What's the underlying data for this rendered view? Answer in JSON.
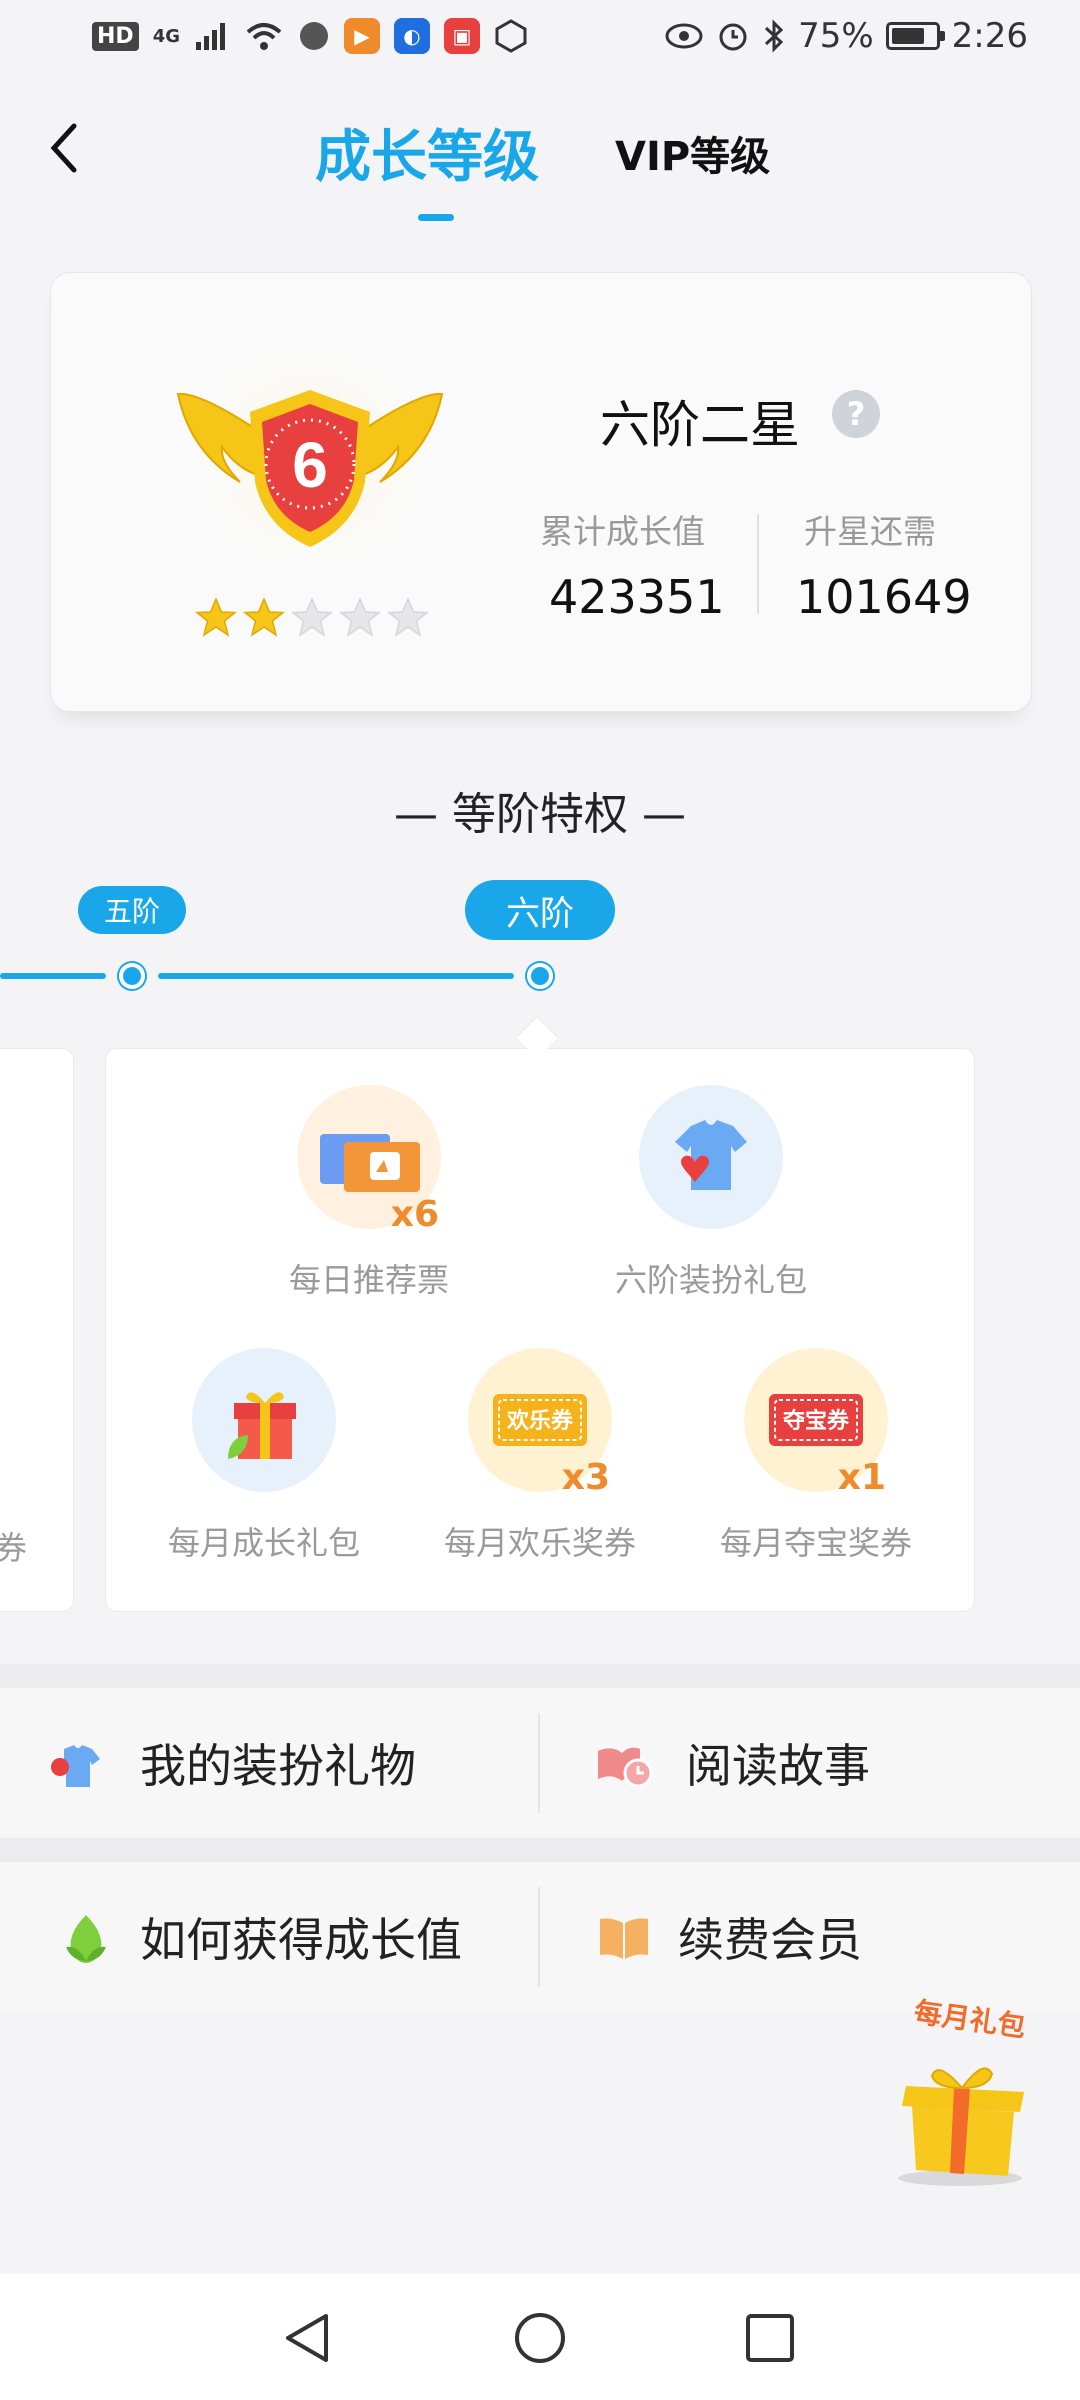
{
  "status_bar": {
    "hd": "HD",
    "network": "4G",
    "battery_text": "75%",
    "time": "2:26",
    "battery_level": 0.75
  },
  "header": {
    "tab_growth": "成长等级",
    "tab_vip": "VIP等级"
  },
  "level_card": {
    "badge_number": "6",
    "level_name": "六阶二星",
    "help": "?",
    "stars_filled": 2,
    "stars_total": 5,
    "cumulative_label": "累计成长值",
    "cumulative_value": "423351",
    "needed_label": "升星还需",
    "needed_value": "101649"
  },
  "privileges": {
    "title": "— 等阶特权 —",
    "stage_prev": "五阶",
    "stage_current": "六阶",
    "prev_panel_partial_text": "券",
    "items": [
      {
        "label": "每日推荐票",
        "badge": "x6",
        "icon": "recommend-ticket-icon"
      },
      {
        "label": "六阶装扮礼包",
        "badge": "",
        "icon": "tshirt-heart-icon"
      },
      {
        "label": "每月成长礼包",
        "badge": "",
        "icon": "gift-leaf-icon"
      },
      {
        "label": "每月欢乐奖券",
        "badge": "x3",
        "icon_text": "欢乐券",
        "icon": "joy-coupon-icon"
      },
      {
        "label": "每月夺宝奖券",
        "badge": "x1",
        "icon_text": "夺宝券",
        "icon": "treasure-coupon-icon"
      }
    ]
  },
  "menu": {
    "my_dressup": "我的装扮礼物",
    "read_story": "阅读故事",
    "how_to_grow": "如何获得成长值",
    "renew_vip": "续费会员"
  },
  "float_gift": {
    "label": "每月礼包"
  },
  "colors": {
    "accent": "#1aa7ea",
    "star": "#f5c518",
    "badge_red": "#e8403e",
    "orange": "#f08b2c"
  }
}
